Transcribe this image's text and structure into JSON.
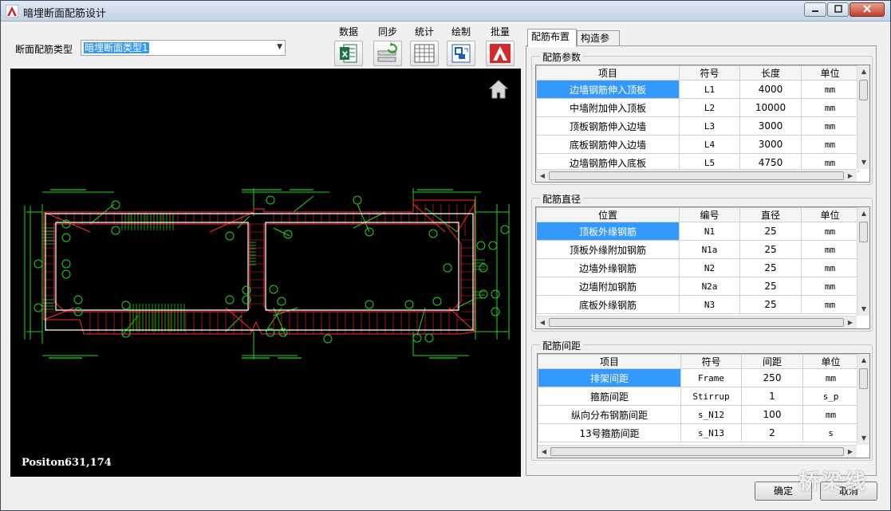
{
  "window": {
    "title": "暗埋断面配筋设计"
  },
  "section_type": {
    "label": "断面配筋类型",
    "value": "暗埋断面类型1"
  },
  "toolbar": [
    {
      "label": "数据",
      "icon": "excel-icon"
    },
    {
      "label": "同步",
      "icon": "sync-icon"
    },
    {
      "label": "统计",
      "icon": "table-icon"
    },
    {
      "label": "绘制",
      "icon": "draw-icon"
    },
    {
      "label": "批量",
      "icon": "autocad-icon"
    }
  ],
  "canvas": {
    "position_label": "Positon:",
    "position_value": "631,174"
  },
  "tabs": [
    {
      "label": "配筋布置"
    },
    {
      "label": "构造参数"
    }
  ],
  "params": {
    "title": "配筋参数",
    "headers": [
      "项目",
      "符号",
      "长度",
      "单位"
    ],
    "rows": [
      [
        "边墙钢筋伸入顶板",
        "L1",
        "4000",
        "mm"
      ],
      [
        "中墙附加伸入顶板",
        "L2",
        "10000",
        "mm"
      ],
      [
        "顶板钢筋伸入边墙",
        "L3",
        "3000",
        "mm"
      ],
      [
        "底板钢筋伸入边墙",
        "L4",
        "3000",
        "mm"
      ],
      [
        "边墙钢筋伸入底板",
        "L5",
        "4750",
        "mm"
      ]
    ]
  },
  "diameters": {
    "title": "配筋直径",
    "headers": [
      "位置",
      "编号",
      "直径",
      "单位"
    ],
    "rows": [
      [
        "顶板外缘钢筋",
        "N1",
        "25",
        "mm"
      ],
      [
        "顶板外缘附加钢筋",
        "N1a",
        "25",
        "mm"
      ],
      [
        "边墙外缘钢筋",
        "N2",
        "25",
        "mm"
      ],
      [
        "边墙附加钢筋",
        "N2a",
        "25",
        "mm"
      ],
      [
        "底板外缘钢筋",
        "N3",
        "25",
        "mm"
      ]
    ]
  },
  "spacing": {
    "title": "配筋间距",
    "headers": [
      "项目",
      "符号",
      "间距",
      "单位"
    ],
    "rows": [
      [
        "排架间距",
        "Frame",
        "250",
        "mm"
      ],
      [
        "箍筋间距",
        "Stirrup",
        "1",
        "s_p"
      ],
      [
        "纵向分布钢筋间距",
        "s_N12",
        "100",
        "mm"
      ],
      [
        "13号箍筋间距",
        "s_N13",
        "2",
        "s"
      ]
    ]
  },
  "buttons": {
    "ok": "确定",
    "cancel": "取消"
  },
  "watermark": "桥梁线"
}
